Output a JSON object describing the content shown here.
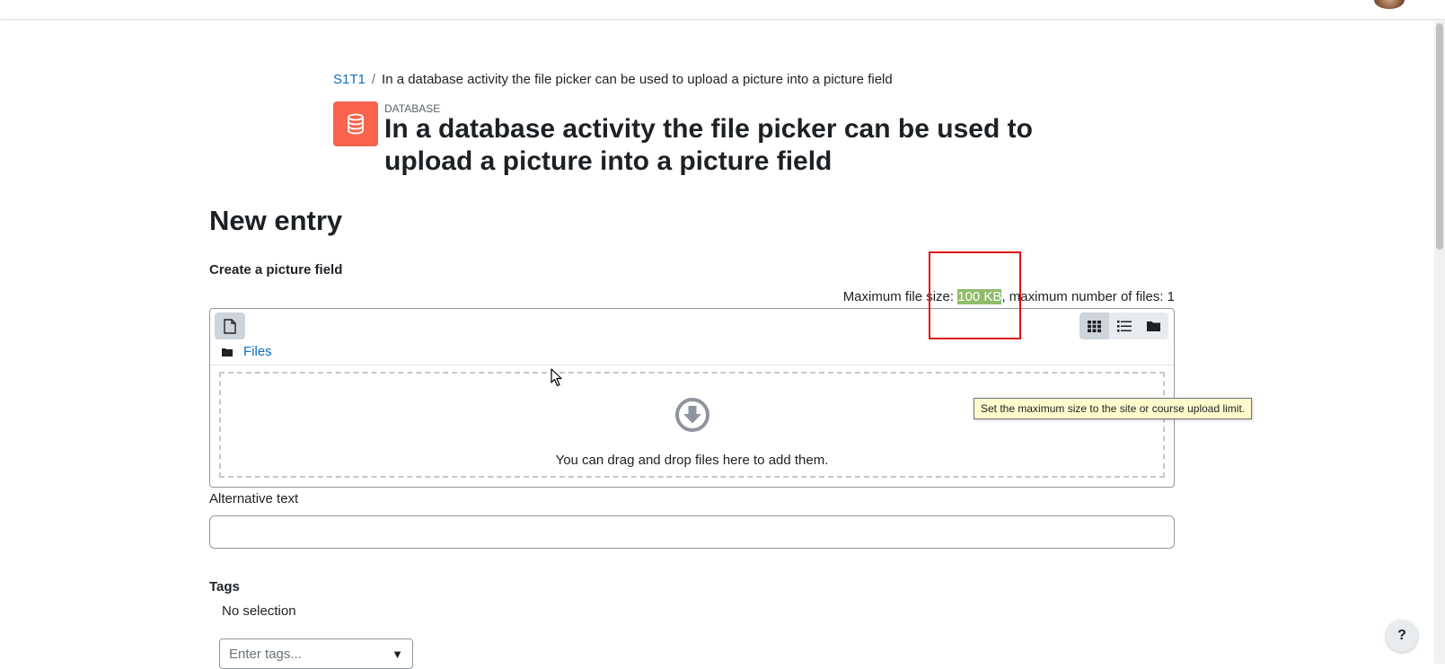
{
  "breadcrumb": {
    "course": "S1T1",
    "current": "In a database activity the file picker can be used to upload a picture into a picture field"
  },
  "header": {
    "module_name": "DATABASE",
    "title": "In a database activity the file picker can be used to upload a picture into a picture field",
    "icon": "database-icon",
    "icon_color": "#f7634d"
  },
  "form": {
    "heading": "New entry",
    "field_label": "Create a picture field",
    "max_size_prefix": "Maximum file size: ",
    "max_size_value": "100 KB",
    "max_files_text": ", maximum number of files: 1",
    "filemanager": {
      "path_label": "Files",
      "drop_text": "You can drag and drop files here to add them."
    },
    "tooltip": "Set the maximum size to the site or course upload limit.",
    "alt_text_label": "Alternative text",
    "alt_text_value": "",
    "tags_label": "Tags",
    "tags_selection": "No selection",
    "tags_placeholder": "Enter tags...",
    "tags_arrow": "▼"
  },
  "help_button": "?",
  "colors": {
    "link": "#0f6cbf",
    "highlight": "#8fbc6a",
    "annotation_box": "#e01010"
  }
}
